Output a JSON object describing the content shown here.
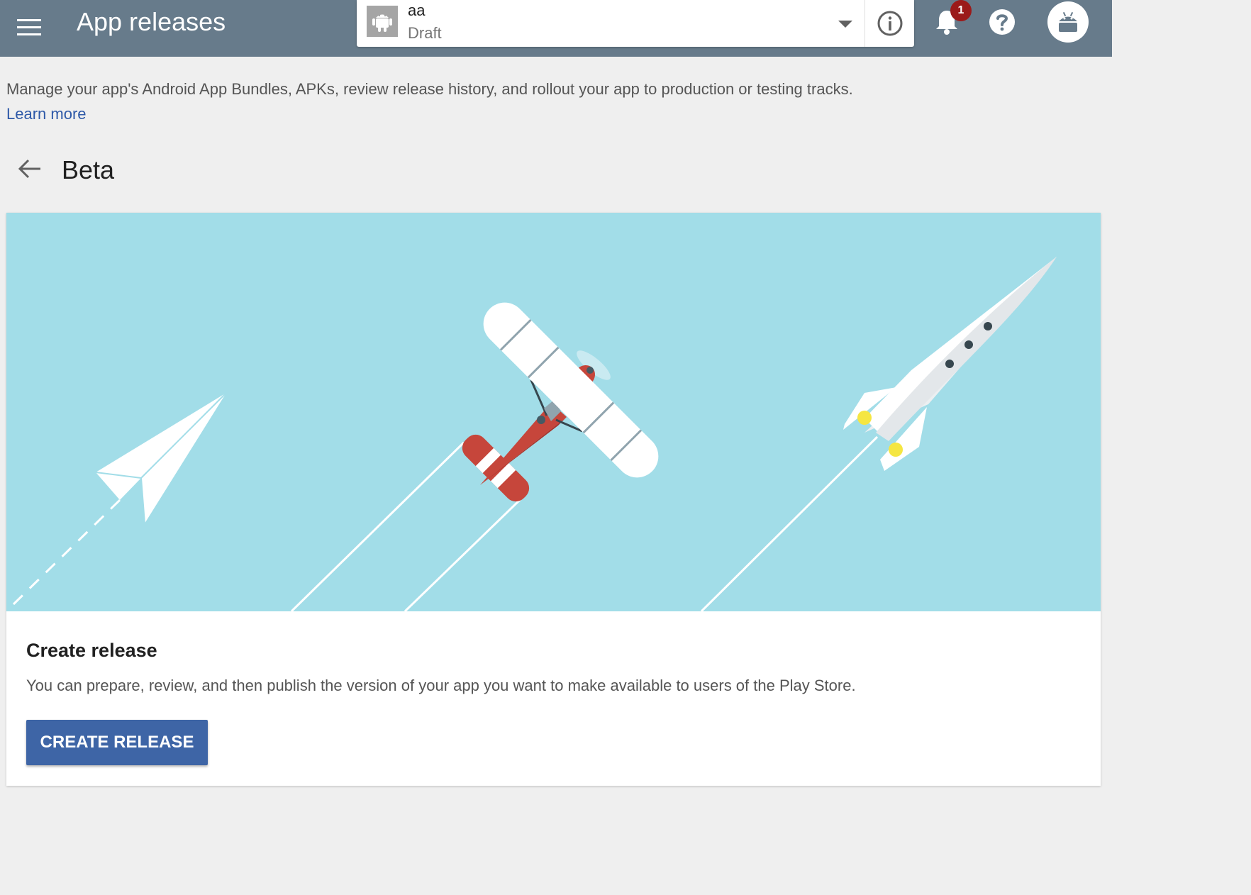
{
  "header": {
    "title": "App releases",
    "notifications_count": "1",
    "icons": [
      "menu-icon",
      "android-icon",
      "chevron-down-icon",
      "info-icon",
      "bell-icon",
      "help-icon",
      "android-avatar-icon"
    ]
  },
  "app_selector": {
    "name": "aa",
    "status": "Draft"
  },
  "intro": {
    "description": "Manage your app's Android App Bundles, APKs, review release history, and rollout your app to production or testing tracks.",
    "learn_more": "Learn more"
  },
  "page": {
    "title": "Beta"
  },
  "card": {
    "title": "Create release",
    "description": "You can prepare, review, and then publish the version of your app you want to make available to users of the Play Store.",
    "button_label": "CREATE RELEASE"
  },
  "colors": {
    "topbar": "#677b8b",
    "hero_bg": "#a2dde8",
    "primary_button": "#3e65a6",
    "link": "#2e59a8",
    "badge": "#9b1a1a"
  }
}
